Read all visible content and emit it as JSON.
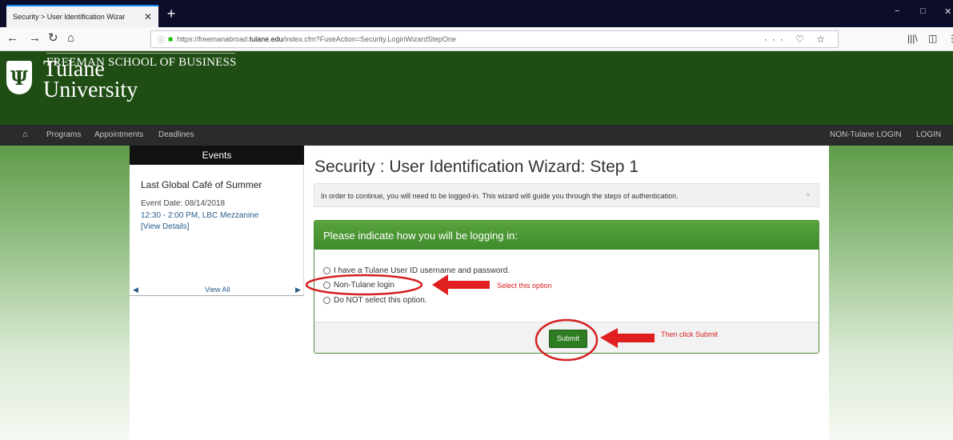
{
  "browser": {
    "tab_title": "Security > User Identification Wizar",
    "tab_close": "✕",
    "new_tab": "+",
    "url_prefix": "https://freemanabroad.",
    "url_host": "tulane.edu",
    "url_path": "/index.cfm?FuseAction=Security.LoginWizardStepOne",
    "url_right_icons": "··· ♡ ☆",
    "controls": {
      "minimize": "−",
      "maximize": "□",
      "close": "✕"
    },
    "nav_icons": {
      "back": "←",
      "forward": "→",
      "reload": "↻",
      "home": "⌂",
      "library": "|||\\",
      "sidebar": "◫",
      "menu": "⋮"
    }
  },
  "site": {
    "name_line1": "Tulane",
    "name_line2": "University",
    "school": "FREEMAN SCHOOL OF BUSINESS",
    "shield_letter": "Ψ"
  },
  "nav": {
    "home_icon": "⌂",
    "items": [
      "Programs",
      "Appointments",
      "Deadlines"
    ],
    "right_items": [
      "NON-Tulane LOGIN",
      "LOGIN"
    ]
  },
  "events": {
    "heading": "Events",
    "title": "Last Global Café of Summer",
    "date": "Event Date: 08/14/2018",
    "time": "12:30 - 2:00 PM, LBC Mezzanine",
    "details_link": "[View Details]",
    "view_all": "View All",
    "prev_icon": "◀",
    "next_icon": "▶"
  },
  "main": {
    "title": "Security : User Identification Wizard: Step 1",
    "alert": "In order to continue, you will need to be logged-in. This wizard will guide you through the steps of authentication.",
    "alert_close": "×",
    "panel_heading": "Please indicate how you will be logging in:",
    "options": [
      "I have a Tulane User ID username and password.",
      "Non-Tulane login",
      "Do NOT select this option."
    ],
    "submit": "Submit"
  },
  "annotations": {
    "select_option": "Select this option",
    "then_submit": "Then click Submit",
    "color": "#d42020"
  },
  "colors": {
    "header_green": "#1f4d14",
    "panel_green": "#4a9a33",
    "button_green": "#2e7d22"
  }
}
